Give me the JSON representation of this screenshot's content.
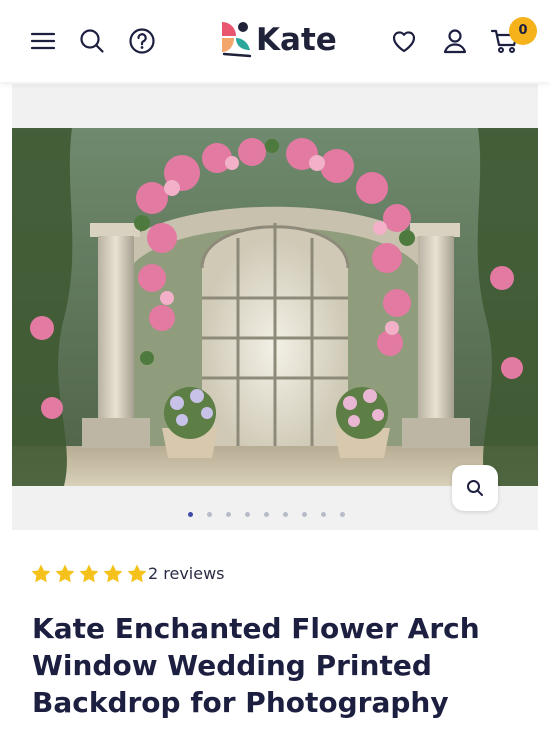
{
  "header": {
    "logo_text": "Kate",
    "cart_count": "0",
    "icons": [
      "menu-icon",
      "search-icon",
      "help-icon",
      "heart-icon",
      "account-icon",
      "cart-icon"
    ],
    "accent_color": "#f6b21b"
  },
  "gallery": {
    "image_subject": "Enchanted flower arch window backdrop",
    "slide_count": 9,
    "active_slide": 1,
    "zoom_icon": "zoom-icon"
  },
  "product": {
    "rating": 5,
    "reviews_label": "2 reviews",
    "title": "Kate Enchanted Flower Arch Window Wedding Printed Backdrop for Photography",
    "star_color": "#f4c21b"
  }
}
